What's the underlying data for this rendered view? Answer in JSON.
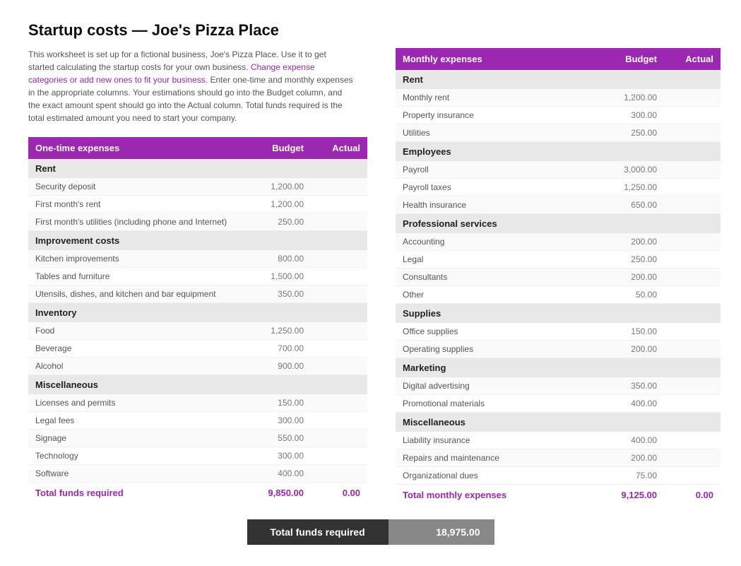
{
  "title": "Startup costs — Joe's Pizza Place",
  "description": {
    "text1": "This worksheet is set up for a fictional business, Joe's Pizza Place. Use it to get started calculating the startup costs for your own business.",
    "highlight": "Change expense categories or add new ones to fit your business.",
    "text2": "Enter one-time and monthly expenses in the appropriate columns. Your estimations should go into the Budget column, and the exact amount spent should go into the Actual column. Total funds required is the total estimated amount you need to start your company."
  },
  "one_time_table": {
    "header": {
      "col1": "One-time expenses",
      "col2": "Budget",
      "col3": "Actual"
    },
    "sections": [
      {
        "name": "Rent",
        "rows": [
          {
            "label": "Security deposit",
            "budget": "1,200.00",
            "actual": ""
          },
          {
            "label": "First month's rent",
            "budget": "1,200.00",
            "actual": ""
          },
          {
            "label": "First month's utilities (including phone and Internet)",
            "budget": "250.00",
            "actual": ""
          }
        ]
      },
      {
        "name": "Improvement costs",
        "rows": [
          {
            "label": "Kitchen improvements",
            "budget": "800.00",
            "actual": ""
          },
          {
            "label": "Tables and furniture",
            "budget": "1,500.00",
            "actual": ""
          },
          {
            "label": "Utensils, dishes, and kitchen and bar equipment",
            "budget": "350.00",
            "actual": ""
          }
        ]
      },
      {
        "name": "Inventory",
        "rows": [
          {
            "label": "Food",
            "budget": "1,250.00",
            "actual": ""
          },
          {
            "label": "Beverage",
            "budget": "700.00",
            "actual": ""
          },
          {
            "label": "Alcohol",
            "budget": "900.00",
            "actual": ""
          }
        ]
      },
      {
        "name": "Miscellaneous",
        "rows": [
          {
            "label": "Licenses and permits",
            "budget": "150.00",
            "actual": ""
          },
          {
            "label": "Legal fees",
            "budget": "300.00",
            "actual": ""
          },
          {
            "label": "Signage",
            "budget": "550.00",
            "actual": ""
          },
          {
            "label": "Technology",
            "budget": "300.00",
            "actual": ""
          },
          {
            "label": "Software",
            "budget": "400.00",
            "actual": ""
          }
        ]
      }
    ],
    "total": {
      "label": "Total funds required",
      "budget": "9,850.00",
      "actual": "0.00"
    }
  },
  "monthly_table": {
    "header": {
      "col1": "Monthly expenses",
      "col2": "Budget",
      "col3": "Actual"
    },
    "sections": [
      {
        "name": "Rent",
        "rows": [
          {
            "label": "Monthly rent",
            "budget": "1,200.00",
            "actual": ""
          },
          {
            "label": "Property insurance",
            "budget": "300.00",
            "actual": ""
          },
          {
            "label": "Utilities",
            "budget": "250.00",
            "actual": ""
          }
        ]
      },
      {
        "name": "Employees",
        "rows": [
          {
            "label": "Payroll",
            "budget": "3,000.00",
            "actual": ""
          },
          {
            "label": "Payroll taxes",
            "budget": "1,250.00",
            "actual": ""
          },
          {
            "label": "Health insurance",
            "budget": "650.00",
            "actual": ""
          }
        ]
      },
      {
        "name": "Professional services",
        "rows": [
          {
            "label": "Accounting",
            "budget": "200.00",
            "actual": ""
          },
          {
            "label": "Legal",
            "budget": "250.00",
            "actual": ""
          },
          {
            "label": "Consultants",
            "budget": "200.00",
            "actual": ""
          },
          {
            "label": "Other",
            "budget": "50.00",
            "actual": ""
          }
        ]
      },
      {
        "name": "Supplies",
        "rows": [
          {
            "label": "Office supplies",
            "budget": "150.00",
            "actual": ""
          },
          {
            "label": "Operating supplies",
            "budget": "200.00",
            "actual": ""
          }
        ]
      },
      {
        "name": "Marketing",
        "rows": [
          {
            "label": "Digital advertising",
            "budget": "350.00",
            "actual": ""
          },
          {
            "label": "Promotional materials",
            "budget": "400.00",
            "actual": ""
          }
        ]
      },
      {
        "name": "Miscellaneous",
        "rows": [
          {
            "label": "Liability insurance",
            "budget": "400.00",
            "actual": ""
          },
          {
            "label": "Repairs and maintenance",
            "budget": "200.00",
            "actual": ""
          },
          {
            "label": "Organizational dues",
            "budget": "75.00",
            "actual": ""
          }
        ]
      }
    ],
    "total": {
      "label": "Total monthly expenses",
      "budget": "9,125.00",
      "actual": "0.00"
    }
  },
  "grand_total": {
    "label": "Total funds required",
    "value": "18,975.00"
  }
}
